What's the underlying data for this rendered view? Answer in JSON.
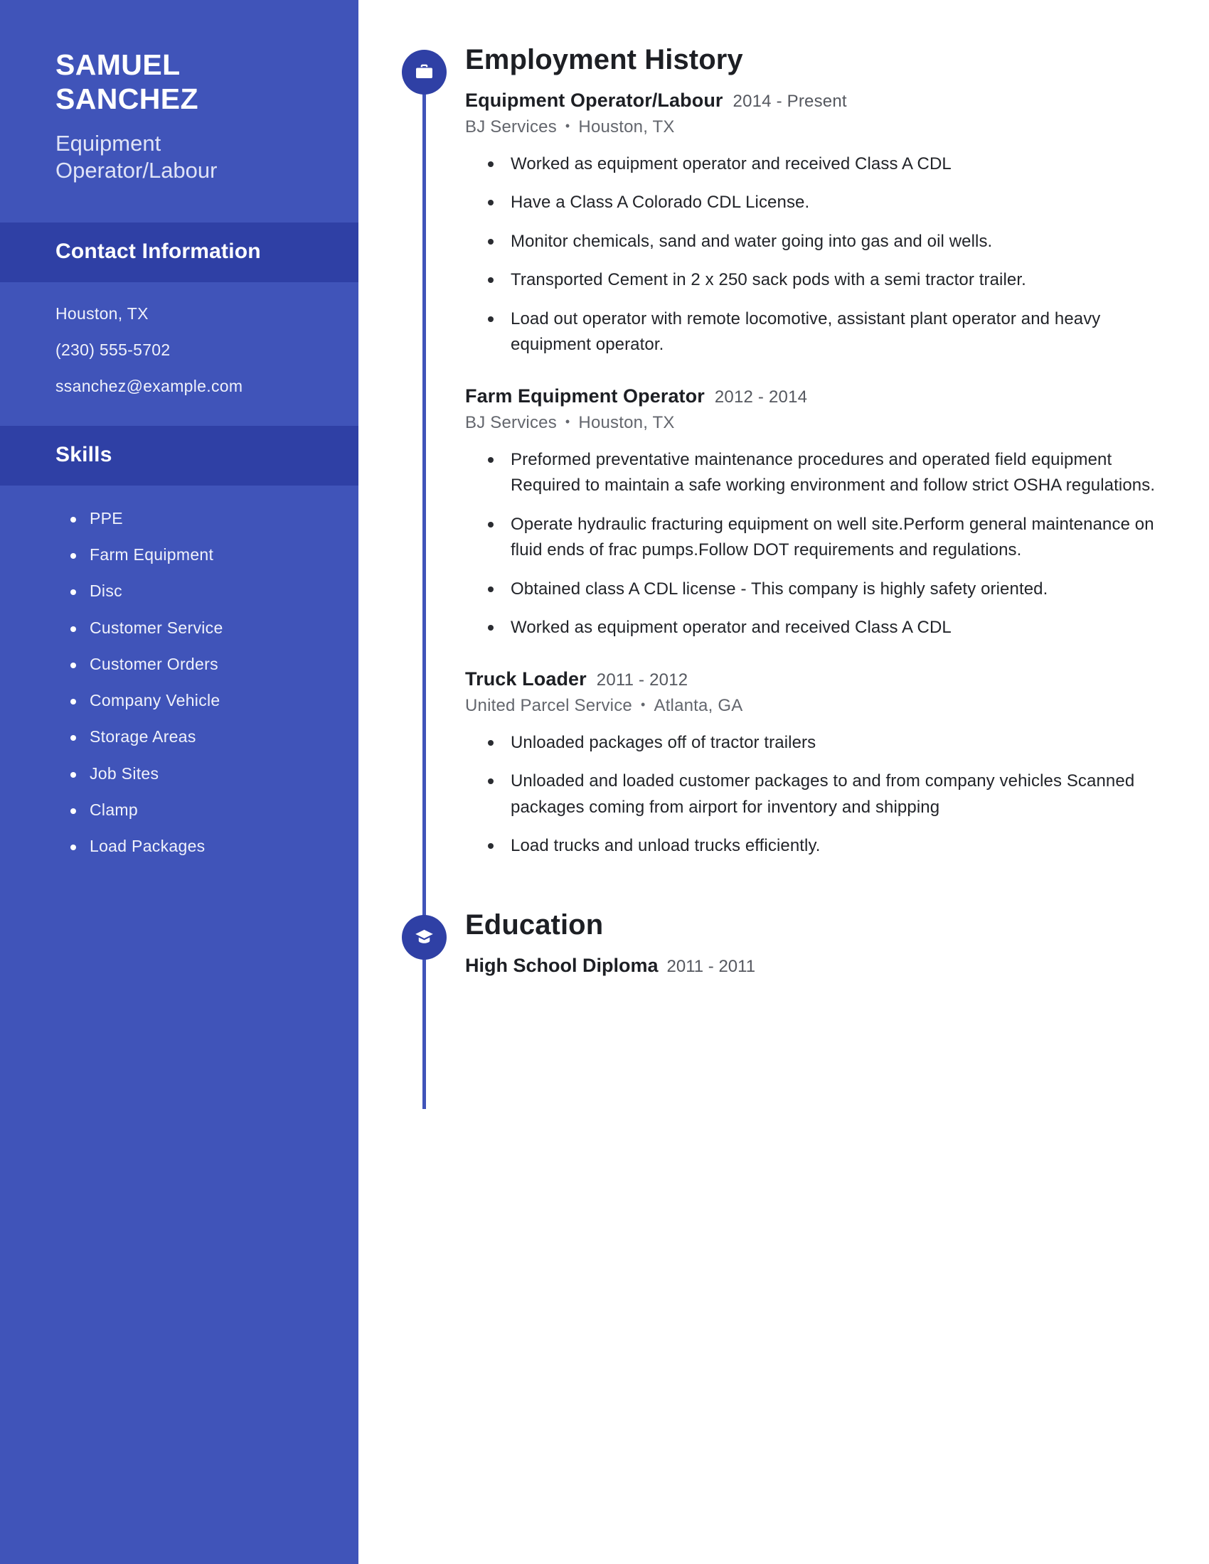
{
  "theme": {
    "sidebar_bg": "#4054b9",
    "band_bg": "#2f40a5",
    "accent": "#2f40a5",
    "text_dark": "#1d1f24",
    "text_muted": "#63666d"
  },
  "sidebar": {
    "first_name": "SAMUEL",
    "last_name": "SANCHEZ",
    "job_title": "Equipment Operator/Labour",
    "contact": {
      "heading": "Contact Information",
      "lines": [
        "Houston, TX",
        "(230) 555-5702",
        "ssanchez@example.com"
      ]
    },
    "skills": {
      "heading": "Skills",
      "items": [
        "PPE",
        "Farm Equipment",
        "Disc",
        "Customer Service",
        "Customer Orders",
        "Company Vehicle",
        "Storage Areas",
        "Job Sites",
        "Clamp",
        "Load Packages"
      ]
    }
  },
  "main": {
    "employment": {
      "heading": "Employment History",
      "icon": "briefcase-icon",
      "entries": [
        {
          "role": "Equipment Operator/Labour",
          "dates": "2014 - Present",
          "company": "BJ Services",
          "location": "Houston, TX",
          "bullets": [
            "Worked as equipment operator and received Class A CDL",
            "Have a Class A Colorado CDL License.",
            "Monitor chemicals, sand and water going into gas and oil wells.",
            "Transported Cement in 2 x 250 sack pods with a semi tractor trailer.",
            "Load out operator with remote locomotive, assistant plant operator and heavy equipment operator."
          ]
        },
        {
          "role": "Farm Equipment Operator",
          "dates": "2012 - 2014",
          "company": "BJ Services",
          "location": "Houston, TX",
          "bullets": [
            "Preformed preventative maintenance procedures and operated field equipment Required to maintain a safe working environment and follow strict OSHA regulations.",
            "Operate hydraulic fracturing equipment on well site.Perform general maintenance on fluid ends of frac pumps.Follow DOT requirements and regulations.",
            "Obtained class A CDL license - This company is highly safety oriented.",
            "Worked as equipment operator and received Class A CDL"
          ]
        },
        {
          "role": "Truck Loader",
          "dates": "2011 - 2012",
          "company": "United Parcel Service",
          "location": "Atlanta, GA",
          "bullets": [
            "Unloaded packages off of tractor trailers",
            "Unloaded and loaded customer packages to and from company vehicles Scanned packages coming from airport for inventory and shipping",
            "Load trucks and unload trucks efficiently."
          ]
        }
      ]
    },
    "education": {
      "heading": "Education",
      "icon": "graduation-cap-icon",
      "entries": [
        {
          "degree": "High School Diploma",
          "dates": "2011 - 2011"
        }
      ]
    }
  },
  "separator": "•"
}
